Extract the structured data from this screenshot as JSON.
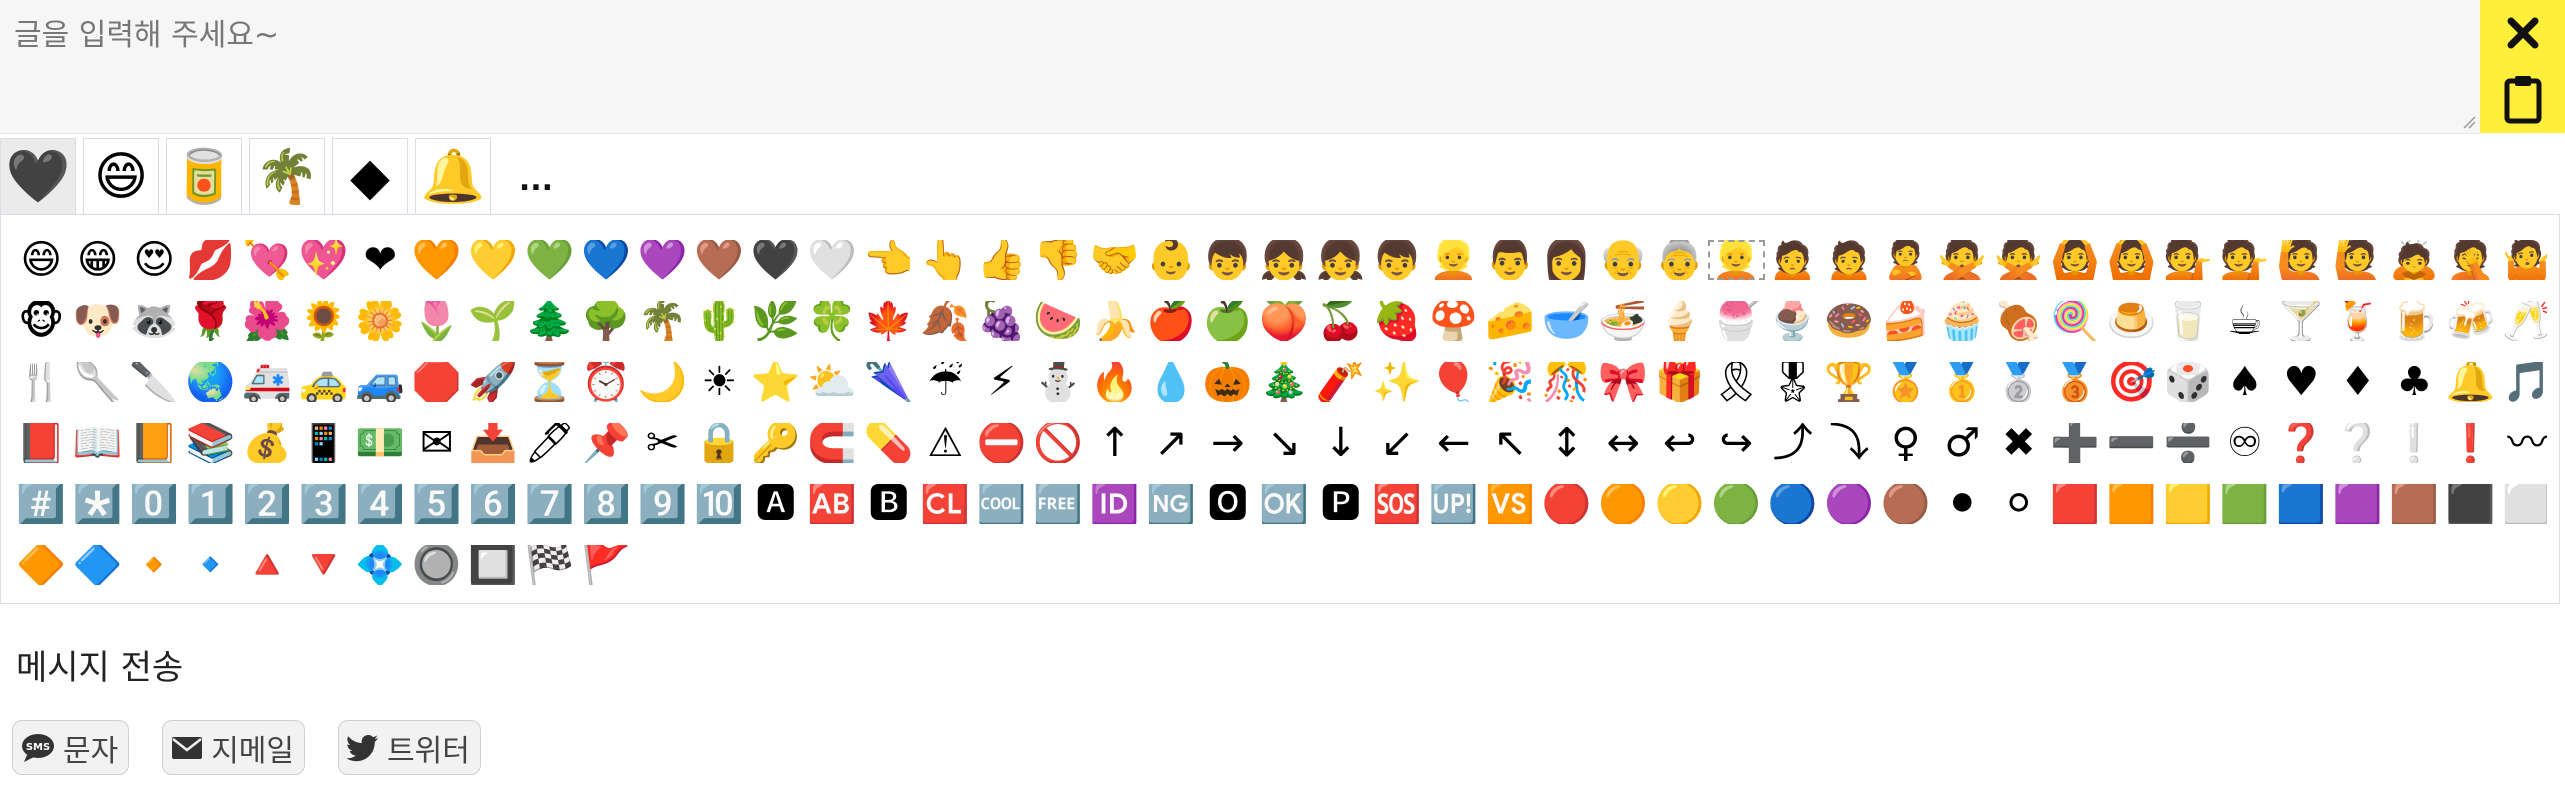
{
  "editor": {
    "placeholder": "글을 입력해 주세요~",
    "value": "",
    "clear_icon": "close-icon",
    "clear_label": "✕",
    "copy_icon": "clipboard-icon",
    "accent_color": "#ffef3b"
  },
  "tabs": [
    {
      "name": "tab-hearts",
      "label": "🖤",
      "active": true
    },
    {
      "name": "tab-smileys",
      "label": "😄",
      "active": false
    },
    {
      "name": "tab-food",
      "label": "🥫",
      "active": false
    },
    {
      "name": "tab-nature",
      "label": "🌴",
      "active": false
    },
    {
      "name": "tab-symbols",
      "label": "◆",
      "active": false
    },
    {
      "name": "tab-objects",
      "label": "🔔",
      "active": false
    }
  ],
  "more_label": "...",
  "emoji_rows": [
    [
      "😄",
      "😁",
      "😍",
      "💋",
      "💘",
      "💖",
      "❤",
      "🧡",
      "💛",
      "💚",
      "💙",
      "💜",
      "🤎",
      "🖤",
      "🤍",
      "👈",
      "👆",
      "👍",
      "👎",
      "🤝",
      "👶",
      "👦",
      "👧",
      "👧",
      "👦",
      "👱",
      "👨",
      "👩",
      "👴",
      "👵",
      "👱",
      "🙍",
      "🙍",
      "🙎",
      "🙅",
      "🙅",
      "🙆",
      "🙆",
      "💁",
      "💁",
      "🙋",
      "🙋",
      "🙇",
      "🤦",
      "🤷",
      "🤷",
      "🤷"
    ],
    [
      "🐵",
      "🐶",
      "🦝",
      "🌹",
      "🌺",
      "🌻",
      "🌼",
      "🌷",
      "🌱",
      "🌲",
      "🌳",
      "🌴",
      "🌵",
      "🌿",
      "🍀",
      "🍁",
      "🍂",
      "🍇",
      "🍉",
      "🍌",
      "🍎",
      "🍏",
      "🍑",
      "🍒",
      "🍓",
      "🍄",
      "🧀",
      "🥣",
      "🍜",
      "🍦",
      "🍧",
      "🍨",
      "🍩",
      "🍰",
      "🧁",
      "🍖",
      "🍭",
      "🍮",
      "🥛",
      "☕",
      "🍸",
      "🍹",
      "🍺",
      "🍻",
      "🥂",
      "🥃",
      "🥤"
    ],
    [
      "🍴",
      "🥄",
      "🔪",
      "🌏",
      "🚑",
      "🚕",
      "🚙",
      "🛑",
      "🚀",
      "⏳",
      "⏰",
      "🌙",
      "☀",
      "⭐",
      "⛅",
      "🌂",
      "☔",
      "⚡",
      "⛄",
      "🔥",
      "💧",
      "🎃",
      "🎄",
      "🧨",
      "✨",
      "🎈",
      "🎉",
      "🎊",
      "🎀",
      "🎁",
      "🎗",
      "🎖",
      "🏆",
      "🏅",
      "🥇",
      "🥈",
      "🥉",
      "🎯",
      "🎲",
      "♠",
      "♥",
      "♦",
      "♣",
      "🔔",
      "🎵",
      "☎",
      "🔍",
      "🔎",
      "💡",
      "📜"
    ],
    [
      "📕",
      "📖",
      "📙",
      "📚",
      "💰",
      "📱",
      "💵",
      "✉",
      "📥",
      "🖊",
      "📌",
      "✂",
      "🔒",
      "🔑",
      "🧲",
      "💊",
      "⚠",
      "⛔",
      "🚫",
      "↑",
      "↗",
      "→",
      "↘",
      "↓",
      "↙",
      "←",
      "↖",
      "↕",
      "↔",
      "↩",
      "↪",
      "⤴",
      "⤵",
      "♀",
      "♂",
      "✖",
      "➕",
      "➖",
      "➗",
      "♾",
      "❓",
      "❔",
      "❕",
      "❗",
      "〰",
      "💲",
      "♻",
      "🔰",
      "⭕",
      "✅",
      "☑",
      "✔",
      "❌",
      "❎",
      "✳",
      "✴",
      "❇",
      "©",
      "®",
      "™"
    ],
    [
      "#️⃣",
      "*️⃣",
      "0️⃣",
      "1️⃣",
      "2️⃣",
      "3️⃣",
      "4️⃣",
      "5️⃣",
      "6️⃣",
      "7️⃣",
      "8️⃣",
      "9️⃣",
      "🔟",
      "🅰",
      "🆎",
      "🅱",
      "🆑",
      "🆒",
      "🆓",
      "🆔",
      "🆖",
      "🅾",
      "🆗",
      "🅿",
      "🆘",
      "🆙",
      "🆚",
      "🔴",
      "🟠",
      "🟡",
      "🟢",
      "🔵",
      "🟣",
      "🟤",
      "⚫",
      "⚪",
      "🟥",
      "🟧",
      "🟨",
      "🟩",
      "🟦",
      "🟪",
      "🟫",
      "⬛",
      "⬜",
      "◼",
      "◻",
      "◾",
      "◽",
      "▪",
      "▫"
    ],
    [
      "🔶",
      "🔷",
      "🔸",
      "🔹",
      "🔺",
      "🔻",
      "💠",
      "🔘",
      "🔲",
      "🏁",
      "🚩"
    ]
  ],
  "highlighted_emoji": "👱",
  "send": {
    "title": "메시지 전송",
    "buttons": [
      {
        "name": "sms-button",
        "icon": "sms-icon",
        "label": "문자"
      },
      {
        "name": "email-button",
        "icon": "envelope-icon",
        "label": "지메일"
      },
      {
        "name": "twitter-button",
        "icon": "twitter-icon",
        "label": "트위터"
      }
    ]
  }
}
